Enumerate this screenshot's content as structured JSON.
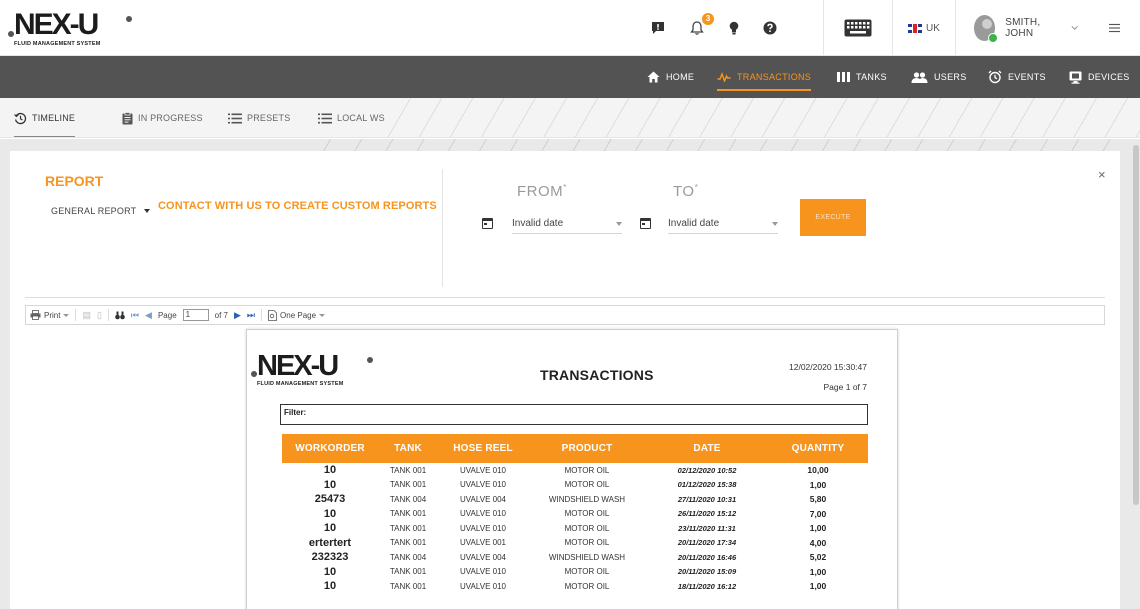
{
  "brand": {
    "logo_text": "NEX-U",
    "tagline": "FLUID MANAGEMENT SYSTEM"
  },
  "topbar": {
    "notification_count": "3",
    "language": "UK",
    "user_name": "SMITH, JOHN",
    "icons": [
      "message-icon",
      "bell-icon",
      "lightbulb-icon",
      "help-icon",
      "keyboard-icon",
      "flag-uk-icon",
      "chevron-down-icon",
      "hamburger-menu-icon"
    ]
  },
  "nav": {
    "items": [
      {
        "label": "HOME",
        "icon": "home-icon"
      },
      {
        "label": "TRANSACTIONS",
        "icon": "pulse-icon"
      },
      {
        "label": "TANKS",
        "icon": "tanks-icon"
      },
      {
        "label": "USERS",
        "icon": "users-icon"
      },
      {
        "label": "EVENTS",
        "icon": "alarm-clock-icon"
      },
      {
        "label": "DEVICES",
        "icon": "devices-icon"
      }
    ],
    "active": "TRANSACTIONS"
  },
  "subtabs": {
    "items": [
      {
        "label": "TIMELINE",
        "icon": "history-icon"
      },
      {
        "label": "IN PROGRESS",
        "icon": "clipboard-icon"
      },
      {
        "label": "PRESETS",
        "icon": "list-icon"
      },
      {
        "label": "LOCAL WS",
        "icon": "list-icon"
      }
    ],
    "active": "TIMELINE"
  },
  "report": {
    "title": "REPORT",
    "selected_report": "GENERAL REPORT",
    "contact_link": "CONTACT WITH US TO CREATE CUSTOM REPORTS",
    "from_label": "FROM",
    "to_label": "TO",
    "required_marker": "*",
    "from_value": "Invalid date",
    "to_value": "Invalid date",
    "execute_label": "EXECUTE",
    "close_label": "×"
  },
  "viewer_toolbar": {
    "print_label": "Print",
    "page_label": "Page",
    "page_value": "1",
    "of_label": "of 7",
    "view_mode": "One Page"
  },
  "document": {
    "title": "TRANSACTIONS",
    "generated": "12/02/2020 15:30:47",
    "page_info": "Page 1 of 7",
    "filter_label": "Filter:",
    "columns": [
      "WORKORDER",
      "TANK",
      "HOSE REEL",
      "PRODUCT",
      "DATE",
      "QUANTITY"
    ],
    "rows": [
      [
        "10",
        "TANK 001",
        "UVALVE 010",
        "MOTOR OIL",
        "02/12/2020 10:52",
        "10,00"
      ],
      [
        "10",
        "TANK 001",
        "UVALVE 010",
        "MOTOR OIL",
        "01/12/2020 15:38",
        "1,00"
      ],
      [
        "25473",
        "TANK 004",
        "UVALVE 004",
        "WINDSHIELD WASH",
        "27/11/2020 10:31",
        "5,80"
      ],
      [
        "10",
        "TANK 001",
        "UVALVE 010",
        "MOTOR OIL",
        "26/11/2020 15:12",
        "7,00"
      ],
      [
        "10",
        "TANK 001",
        "UVALVE 010",
        "MOTOR OIL",
        "23/11/2020 11:31",
        "1,00"
      ],
      [
        "ertertert",
        "TANK 001",
        "UVALVE 001",
        "MOTOR OIL",
        "20/11/2020 17:34",
        "4,00"
      ],
      [
        "232323",
        "TANK 004",
        "UVALVE 004",
        "WINDSHIELD WASH",
        "20/11/2020 16:46",
        "5,02"
      ],
      [
        "10",
        "TANK 001",
        "UVALVE 010",
        "MOTOR OIL",
        "20/11/2020 15:09",
        "1,00"
      ],
      [
        "10",
        "TANK 001",
        "UVALVE 010",
        "MOTOR OIL",
        "18/11/2020 16:12",
        "1,00"
      ]
    ]
  },
  "colors": {
    "accent": "#f7941d",
    "navbar": "#535353"
  }
}
